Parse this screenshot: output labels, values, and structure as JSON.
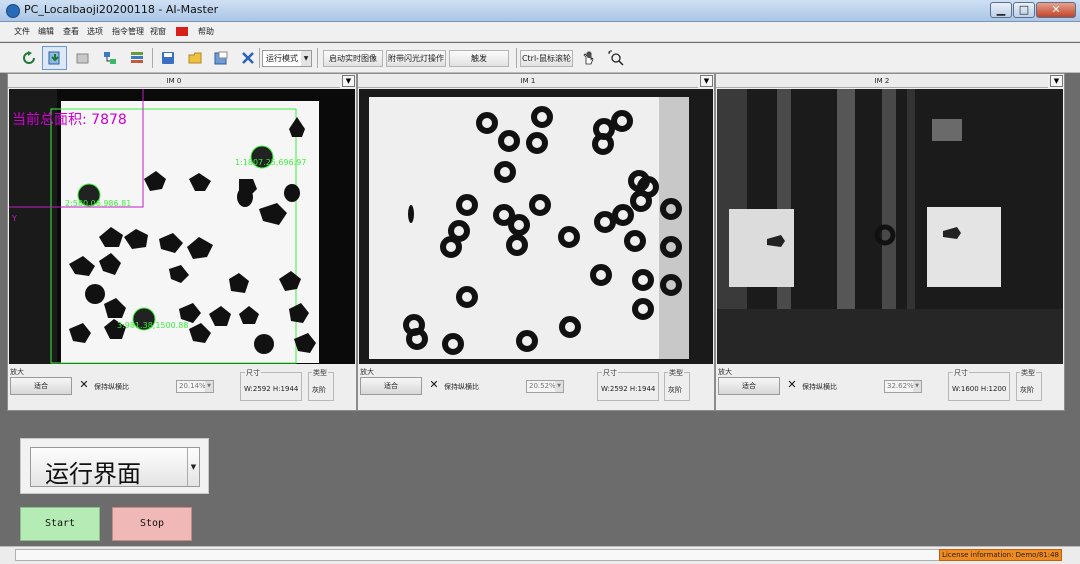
{
  "window": {
    "title": "PC_Localbaoji20200118 - AI-Master",
    "minimize": "▁",
    "maximize": "□",
    "close": "✕"
  },
  "menu": {
    "file": "文件",
    "edit": "编辑",
    "view": "查看",
    "options": "选项",
    "command_manage": "指令管理",
    "window": "视窗",
    "help": "帮助"
  },
  "toolbar": {
    "run_mode": "运行模式",
    "start_realtime": "启动实时图像",
    "flash_op": "附带闪光灯操作",
    "trigger": "触发",
    "ctrl_wheel": "Ctrl-鼠标滚轮",
    "icons": [
      "refresh-icon",
      "import-icon",
      "export-icon",
      "flow-icon",
      "list-icon",
      "save-icon",
      "open-folder-icon",
      "save-as-icon",
      "delete-icon",
      "hand-icon",
      "zoom-icon"
    ]
  },
  "panels": [
    {
      "tab": "IM 0",
      "zoom_label": "放大",
      "fit": "适合",
      "keep_ratio": "保持纵横比",
      "zoom_value": "20.14%",
      "size_label": "尺寸",
      "size_value": "W:2592  H:1944",
      "type_label": "类型",
      "type_value": "灰阶",
      "overlay_text": "当前总面积: 7878",
      "detections": [
        {
          "label": "1:1807.25,696.97"
        },
        {
          "label": "2:580.06,986.81"
        },
        {
          "label": "3:981.38,1500.88"
        }
      ],
      "axis_label": "Y"
    },
    {
      "tab": "IM 1",
      "zoom_label": "放大",
      "fit": "适合",
      "keep_ratio": "保持纵横比",
      "zoom_value": "20.52%",
      "size_label": "尺寸",
      "size_value": "W:2592  H:1944",
      "type_label": "类型",
      "type_value": "灰阶"
    },
    {
      "tab": "IM 2",
      "zoom_label": "放大",
      "fit": "适合",
      "keep_ratio": "保持纵横比",
      "zoom_value": "32.62%",
      "size_label": "尺寸",
      "size_value": "W:1600  H:1200",
      "type_label": "类型",
      "type_value": "灰阶"
    }
  ],
  "controls": {
    "mode": "运行界面",
    "start": "Start",
    "stop": "Stop"
  },
  "status": {
    "license": "License information: Demo/81:48"
  },
  "colors": {
    "start_bg": "#b5ecb5",
    "stop_bg": "#f1b8b8",
    "license_bg": "#f08a1d",
    "overlay_magenta": "#d000d0",
    "detect_green": "#3cf03c"
  }
}
